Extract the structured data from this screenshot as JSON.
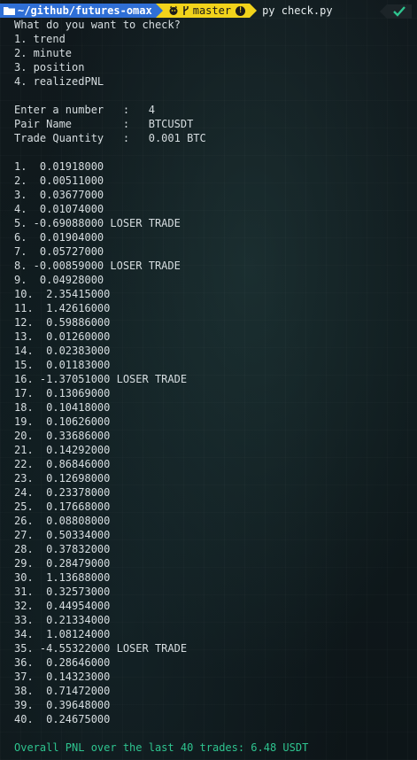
{
  "prompt": {
    "path": "~/github/futures-omax",
    "branch": "master",
    "command": "py check.py"
  },
  "question": "What do you want to check?",
  "menu": [
    "1. trend",
    "2. minute",
    "3. position",
    "4. realizedPNL"
  ],
  "inputs": [
    {
      "label": "Enter a number   :   ",
      "value": "4"
    },
    {
      "label": "Pair Name        :   ",
      "value": "BTCUSDT"
    },
    {
      "label": "Trade Quantity   :   ",
      "value": "0.001 BTC"
    }
  ],
  "trades": [
    "1.  0.01918000",
    "2.  0.00511000",
    "3.  0.03677000",
    "4.  0.01074000",
    "5. -0.69088000 LOSER TRADE",
    "6.  0.01904000",
    "7.  0.05727000",
    "8. -0.00859000 LOSER TRADE",
    "9.  0.04928000",
    "10.  2.35415000",
    "11.  1.42616000",
    "12.  0.59886000",
    "13.  0.01260000",
    "14.  0.02383000",
    "15.  0.01183000",
    "16. -1.37051000 LOSER TRADE",
    "17.  0.13069000",
    "18.  0.10418000",
    "19.  0.10626000",
    "20.  0.33686000",
    "21.  0.14292000",
    "22.  0.86846000",
    "23.  0.12698000",
    "24.  0.23378000",
    "25.  0.17668000",
    "26.  0.08808000",
    "27.  0.50334000",
    "28.  0.37832000",
    "29.  0.28479000",
    "30.  1.13688000",
    "31.  0.32573000",
    "32.  0.44954000",
    "33.  0.21334000",
    "34.  1.08124000",
    "35. -4.55322000 LOSER TRADE",
    "36.  0.28646000",
    "37.  0.14323000",
    "38.  0.71472000",
    "39.  0.39648000",
    "40.  0.24675000"
  ],
  "summary": "Overall PNL over the last 40 trades: 6.48 USDT",
  "colors": {
    "path_bg": "#2f6fd6",
    "git_bg": "#f2d31b",
    "summary": "#2ec48f",
    "status_ok": "#2ec48f"
  }
}
